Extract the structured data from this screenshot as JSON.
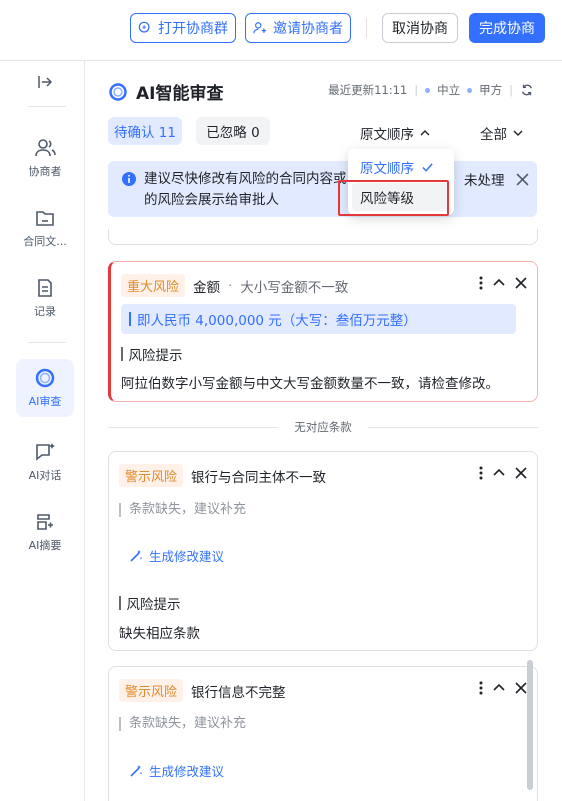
{
  "toolbar": {
    "open_group": "打开协商群",
    "invite": "邀请协商者",
    "cancel": "取消协商",
    "complete": "完成协商"
  },
  "sidebar": {
    "items": [
      {
        "label": "协商者",
        "icon": "people-icon"
      },
      {
        "label": "合同文...",
        "icon": "folder-icon"
      },
      {
        "label": "记录",
        "icon": "document-icon"
      },
      {
        "label": "AI审查",
        "icon": "ai-review-icon",
        "active": true
      },
      {
        "label": "AI对话",
        "icon": "ai-chat-icon"
      },
      {
        "label": "AI摘要",
        "icon": "ai-summary-icon"
      }
    ]
  },
  "header": {
    "title": "AI智能审查",
    "updated": "最近更新11:11",
    "stance1": "中立",
    "stance2": "甲方"
  },
  "filters": {
    "pending": "待确认 11",
    "ignored": "已忽略 0",
    "sort": "原文顺序",
    "scope": "全部"
  },
  "banner": {
    "text": "建议尽快修改有风险的合同内容或",
    "text_tail": "未处理",
    "line2": "的风险会展示给审批人"
  },
  "dropdown": {
    "option1": "原文顺序",
    "option2": "风险等级"
  },
  "cards": [
    {
      "tag": "重大风险",
      "title": "金额",
      "subtitle": "大小写金额不一致",
      "highlight": "即人民币 4,000,000 元（大写：叁佰万元整）",
      "label": "风险提示",
      "body": "阿拉伯数字小写金额与中文大写金额数量不一致，请检查修改。"
    },
    {
      "tag": "警示风险",
      "title": "银行与合同主体不一致",
      "quote": "条款缺失，建议补充",
      "action": "生成修改建议",
      "label": "风险提示",
      "body": "缺失相应条款"
    },
    {
      "tag": "警示风险",
      "title": "银行信息不完整",
      "quote": "条款缺失，建议补充",
      "action": "生成修改建议"
    }
  ],
  "divider_text": "无对应条款",
  "colors": {
    "accent": "#3370ff",
    "danger": "#e5383b",
    "warning": "#e08b2c"
  }
}
